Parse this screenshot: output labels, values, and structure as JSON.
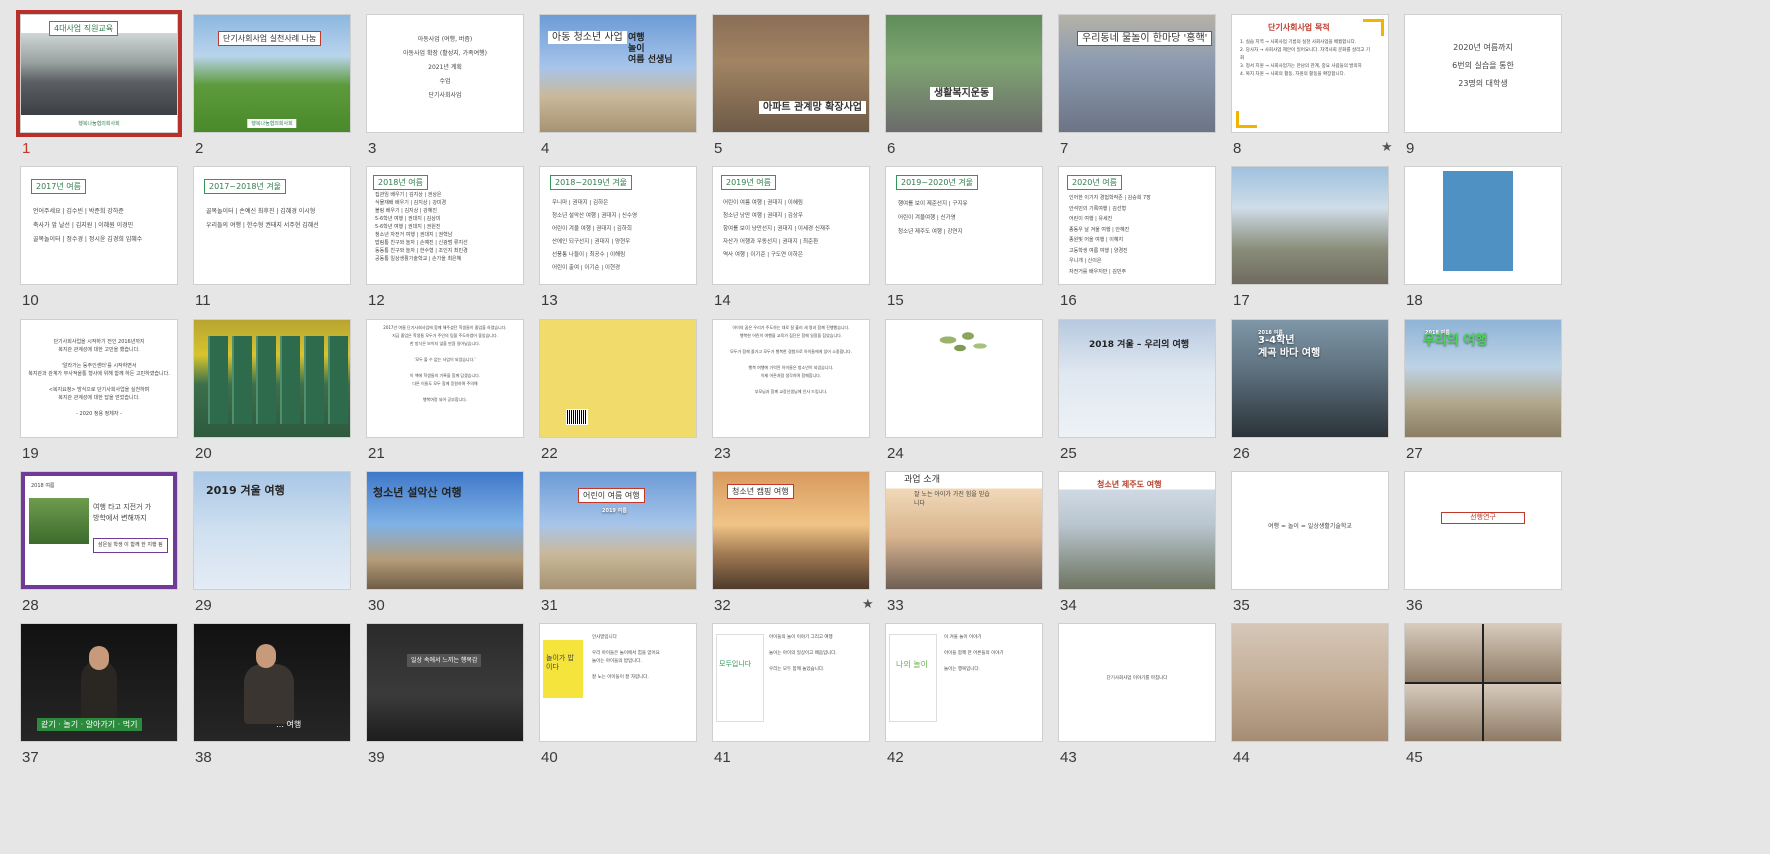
{
  "slides": [
    {
      "num": "1",
      "title": "4대사업 직원교육",
      "logo": "행복나눔협의회사회",
      "selected": true
    },
    {
      "num": "2",
      "title": "단기사회사업 실천사례 나눔",
      "logo": "행복나눔협의회사회"
    },
    {
      "num": "3",
      "lines": "아동사업 (여행, 버즘)\n아동사업 확장 (활성지, 가족여행)\n2021년 계획\n수업\n단기사회사업"
    },
    {
      "num": "4",
      "title": "아동 청소년 사업",
      "side": "여행\n놀이\n여름 선생님"
    },
    {
      "num": "5",
      "title": "아파트 관계망 확장사업"
    },
    {
      "num": "6",
      "title": "생활복지운동"
    },
    {
      "num": "7",
      "title": "우리동네 물놀이 한마당 '홍핵'"
    },
    {
      "num": "8",
      "title": "단기사회사업 목적",
      "lines": "1. 실습 지역 → 사회사업 기름의 실천 사회사업을 배웠합니다.\n2. 당사자 → 사회사업 제안이 일어요니다. 자역사회 문화를 살리고 기회\n3. 정서 지원 → 사회사업가는 만남의 관계, 중요 사람들의 발의하\n4. 복지 차원 → 사회의 활동, 자원의 활동을 확장합니다.",
      "star": true
    },
    {
      "num": "9",
      "lines": "2020년 여름까지\n6번의 실습을 통한\n23명의 대학생"
    },
    {
      "num": "10",
      "title": "2017년 여름",
      "lines": "언어주세요 | 김수빈 | 박준희 강하준\n축사가 앞 날선 | 김지원 | 이혜원 이경민\n골목놀이터 | 정수경 | 정시윤 김경희 임혜수"
    },
    {
      "num": "11",
      "title": "2017~2018년 겨울",
      "lines": "골목놀이터 | 손예신 최후진 | 김혜경 이시형\n우리들의 여행 | 한수형 권태지 서주현 김혜선"
    },
    {
      "num": "12",
      "title": "2018년 여름",
      "lines": "집관임 배우기 | 김지상 | 권상은\n식물재배 배우기 | 김지상 | 강미경\n볼링 배우기 | 김지상 | 강혜진\n5-6학년 여행 | 권대지 | 김상미\n5-6학년 여행 | 권대지 | 권원진\n청소년 자전거 여행 | 권대지 | 권혁남\n밥림통 친구와 놀자 | 손예진 | 신광범 류지선\n동동통 친구와 놀자 | 한수형 | 조인지 최민경\n공동통 일상생활기술학교 | 손가을 최은혜"
    },
    {
      "num": "13",
      "title": "2018~2019년 겨울",
      "lines": "우니마 | 권대지 | 김하은\n청소년 설악산 여행 | 권대지 | 신수영\n어린이 겨울 여행 | 권대지 | 김하희\n산에인 되구선지 | 권대지 | 양현우\n선풍통 나들이 | 최공수 | 이해림\n어린이 출여 | 이기순 | 이현경"
    },
    {
      "num": "14",
      "title": "2019년 여름",
      "lines": "어린이 여름 여행 | 권대지 | 이혜림\n청소년 낭만 여행 | 권대지 | 김상우\n항여를 보이 냥만선지 | 권대지 | 이세경 신재주\n자산가 어행과 우동선지 | 권대지 | 최준환\n역사 여행 | 이기준 | 구도연 이하은"
    },
    {
      "num": "15",
      "title": "2019~2020년 겨울",
      "lines": "행여를 보이 제준선지 | 구지유\n어린이 겨울여행 | 신가영\n청소년 제주도 여행 | 강연지"
    },
    {
      "num": "16",
      "title": "2020년 여름",
      "lines": "인어한 이기지 경험학작존 | 김승희 7장\n안석민의 기록여행 | 김선형\n어린이 여행 | 유세진\n종동우 날 겨울 여행 | 안혜진\n종원빛 어을 여행 | 이혜지\n고등학생 여름 여행 | 양경진\n우니개 | 신이은\n자전거를 배우지만 | 김민주"
    },
    {
      "num": "17"
    },
    {
      "num": "18"
    },
    {
      "num": "19",
      "lines": "단기사회사업을 시작하기 전인 2016년까지\n복지관 관계성에 대한 고민을 했습니다.\n\n'알라가는 등주인센터'를 시작하면서\n복지관과 관계가 무사적을통 형사에 위해 함께 하든 고민하였습니다.\n\n<복지요청> 방식으로 단기사회사업을 실천하며\n복지관 관계성에 대한 답을 얻었습니다.\n\n- 2020 정용 정체자 -"
    },
    {
      "num": "20"
    },
    {
      "num": "21",
      "lines": "2017년 여름 단기사회사업에 함께 해주셨던 학생들이 졸업을 하였습니다.\n지금 졸업은 학생들 모두가 주인의 팀을 주도하였어 좋았습니다.\n한 방식은 보이지 않을 만큼 일어났습니다.\n\n '모두 불 수 없는 사업이 되었습니다.'\n\n이 책에 학생들의 기록을 함께 담겠습니다.\n다른 이들도 모두 함께 응원하며 주의해\n\n행복여정 되어 공부합니다."
    },
    {
      "num": "22"
    },
    {
      "num": "23",
      "lines": "아이의 꿈은 우리가 주도하는 대로 잘 흘러 세 명과 함께 진행했습니다.\n행복한 어린이 여행을 교육가 집단은 함께 일정을 잡았습니다.\n\n모두가 함께 즐기고 모두가 행복한 경험으로 아이들에게 있어 소중합니다.\n\n행복 여행에 기억된 아이들은 청소년이 되었습니다.\n이제 어른처럼 생각하며 함께합니다.\n\n부모님과 함께 교장선생님께 인사 드립니다."
    },
    {
      "num": "24"
    },
    {
      "num": "25",
      "title": "2018 겨울 – 우리의 여행"
    },
    {
      "num": "26",
      "title": "3-4학년\n계곡 바다 여행",
      "kicker": "2018 여름"
    },
    {
      "num": "27",
      "title": "우리의 여행",
      "kicker": "2018 여름"
    },
    {
      "num": "28",
      "kicker": "2018 여름",
      "title": "여행 타고 지전거 가\n방학에서 변해까지",
      "sub": "삼은실 학생 이 함께 한 지행 됨"
    },
    {
      "num": "29",
      "title": "2019 겨울 여행"
    },
    {
      "num": "30",
      "title": "청소년 설악산 여행"
    },
    {
      "num": "31",
      "title": "어린이 여름 여행",
      "sub": "2019 여름"
    },
    {
      "num": "32",
      "title": "청소년 캠핑 여행",
      "star": true
    },
    {
      "num": "33",
      "title": "과업 소개",
      "lines": "잘 노는 아이가 가진 힘을 믿습\n니다"
    },
    {
      "num": "34",
      "title": "청소년 제주도 여행"
    },
    {
      "num": "35",
      "lines": "여행 = 놀이 = 일상생활기술학교"
    },
    {
      "num": "36",
      "title": "선행연구"
    },
    {
      "num": "37",
      "banner": "같기 · 놀기 · 알아가기 · 먹기"
    },
    {
      "num": "38",
      "banner": "… 여행"
    },
    {
      "num": "39",
      "title": "일상 속에서 느끼는 행복감"
    },
    {
      "num": "40",
      "cover": "놀이가 밥이다",
      "lines": "인사말입니다\n\n우리 아이들은 놀이에서 힘을 얻어요\n놀이는 아이들의 밥입니다.\n\n잘 노는 아이들이 잘 자랍니다."
    },
    {
      "num": "41",
      "cover": "모두입니다",
      "lines": "아이들의 놀이 이야기 그리고 여행\n\n놀이는 아이의 일상이고 배움입니다.\n\n우리는 모두 함께 놀았습니다."
    },
    {
      "num": "42",
      "cover": "나의 놀이",
      "lines": "이 겨울 놀이 이야기\n\n아이들 함께 한 어른들의 이야기\n\n놀이는 행복입니다."
    },
    {
      "num": "43",
      "lines": "단기사회사업 이야기를 마칩니다"
    },
    {
      "num": "44"
    },
    {
      "num": "45"
    }
  ]
}
